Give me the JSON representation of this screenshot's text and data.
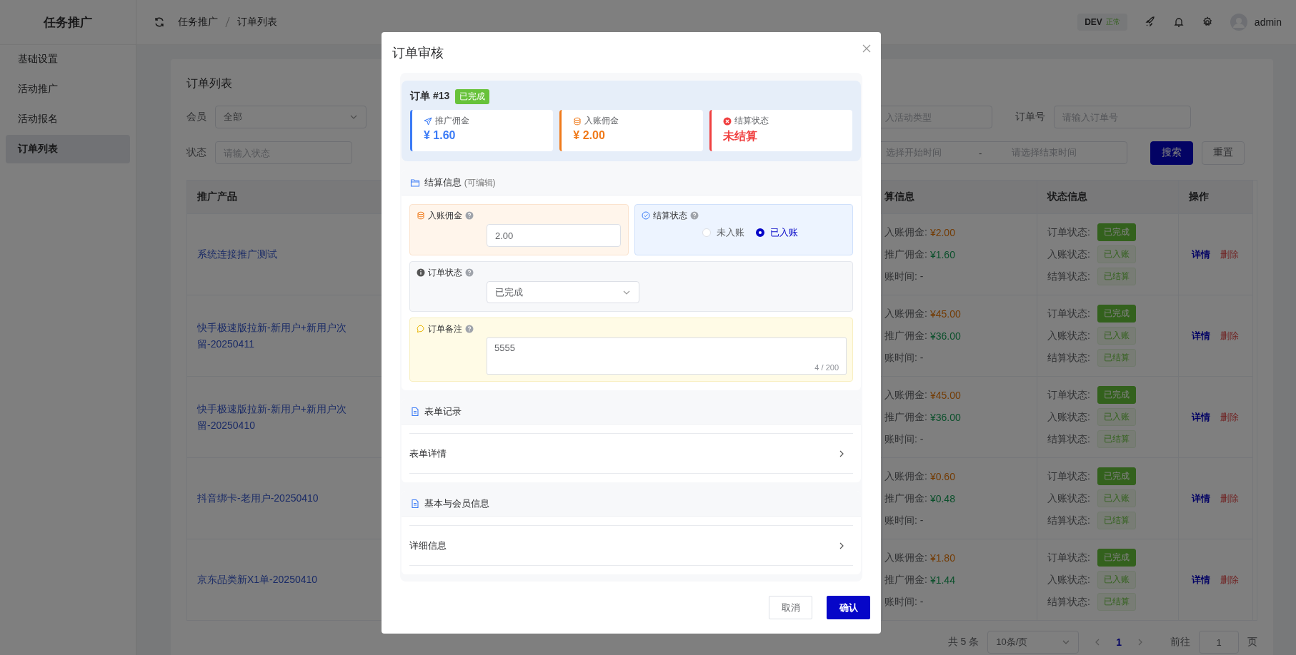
{
  "sidebar": {
    "brand": "任务推广",
    "items": [
      {
        "label": "基础设置",
        "selected": false
      },
      {
        "label": "活动推广",
        "selected": false
      },
      {
        "label": "活动报名",
        "selected": false
      },
      {
        "label": "订单列表",
        "selected": true
      }
    ]
  },
  "header": {
    "breadcrumb": [
      "任务推广",
      "订单列表"
    ],
    "env": {
      "name": "DEV",
      "status": "正常"
    },
    "user": "admin"
  },
  "page": {
    "title": "订单列表",
    "filters": {
      "member": {
        "label": "会员",
        "value": "全部"
      },
      "activity_type": {
        "placeholder": "入活动类型"
      },
      "order_no": {
        "label": "订单号",
        "placeholder": "请输入订单号"
      },
      "status": {
        "label": "状态",
        "placeholder": "请输入状态"
      },
      "date_range": {
        "start_placeholder": "选择开始时间",
        "separator": "-",
        "end_placeholder": "请选择结束时间"
      },
      "buttons": [
        "搜索",
        "重置"
      ]
    },
    "table": {
      "columns": [
        "推广产品",
        "算信息",
        "状态信息",
        "操作"
      ],
      "rows": [
        {
          "product": "系统连接推广测试",
          "settlement": [
            {
              "kind": "income",
              "label": "入账佣金:",
              "value": "¥2.00"
            },
            {
              "kind": "promo",
              "label": "推广佣金:",
              "value": "¥1.60"
            },
            {
              "kind": "time",
              "text": "账时间: -"
            }
          ],
          "statuses": [
            {
              "kind": "solid",
              "label": "订单状态:",
              "tag": "已完成"
            },
            {
              "kind": "light",
              "label": "入账状态:",
              "tag": "已入账"
            },
            {
              "kind": "light",
              "label": "结算状态:",
              "tag": "已结算"
            }
          ],
          "actions": [
            "详情",
            "删除"
          ]
        },
        {
          "product": "快手极速版拉新-新用户+新用户次留-20250411",
          "settlement": [
            {
              "kind": "income",
              "label": "入账佣金:",
              "value": "¥45.00"
            },
            {
              "kind": "promo",
              "label": "推广佣金:",
              "value": "¥36.00"
            },
            {
              "kind": "time",
              "text": "账时间: -"
            }
          ],
          "statuses": [
            {
              "kind": "solid",
              "label": "订单状态:",
              "tag": "已完成"
            },
            {
              "kind": "light",
              "label": "入账状态:",
              "tag": "已入账"
            },
            {
              "kind": "light",
              "label": "结算状态:",
              "tag": "已结算"
            }
          ],
          "actions": [
            "详情",
            "删除"
          ]
        },
        {
          "product": "快手极速版拉新-新用户+新用户次留-20250410",
          "settlement": [
            {
              "kind": "income",
              "label": "入账佣金:",
              "value": "¥45.00"
            },
            {
              "kind": "promo",
              "label": "推广佣金:",
              "value": "¥36.00"
            },
            {
              "kind": "time",
              "text": "账时间: -"
            }
          ],
          "statuses": [
            {
              "kind": "solid",
              "label": "订单状态:",
              "tag": "已完成"
            },
            {
              "kind": "light",
              "label": "入账状态:",
              "tag": "已入账"
            },
            {
              "kind": "light",
              "label": "结算状态:",
              "tag": "已结算"
            }
          ],
          "actions": [
            "详情",
            "删除"
          ]
        },
        {
          "product": "抖音绑卡-老用户-20250410",
          "settlement": [
            {
              "kind": "income",
              "label": "入账佣金:",
              "value": "¥0.60"
            },
            {
              "kind": "promo",
              "label": "推广佣金:",
              "value": "¥0.48"
            },
            {
              "kind": "time",
              "text": "账时间: -"
            }
          ],
          "statuses": [
            {
              "kind": "solid",
              "label": "订单状态:",
              "tag": "已完成"
            },
            {
              "kind": "light",
              "label": "入账状态:",
              "tag": "已入账"
            },
            {
              "kind": "light",
              "label": "结算状态:",
              "tag": "已结算"
            }
          ],
          "actions": [
            "详情",
            "删除"
          ]
        },
        {
          "product": "京东品类新X1单-20250410",
          "settlement": [
            {
              "kind": "income",
              "label": "入账佣金:",
              "value": "¥1.80"
            },
            {
              "kind": "promo",
              "label": "推广佣金:",
              "value": "¥1.44"
            },
            {
              "kind": "time",
              "text": "账时间: -"
            }
          ],
          "statuses": [
            {
              "kind": "solid",
              "label": "订单状态:",
              "tag": "已完成"
            },
            {
              "kind": "light",
              "label": "入账状态:",
              "tag": "已入账"
            },
            {
              "kind": "light",
              "label": "结算状态:",
              "tag": "已结算"
            }
          ],
          "actions": [
            "详情",
            "删除"
          ]
        }
      ]
    },
    "pagination": {
      "total": "共 5 条",
      "page_size": "10条/页",
      "pages": [
        {
          "label": "1",
          "selected": true
        }
      ],
      "goto_label": "前往",
      "goto_value": "1",
      "page_suffix": "页"
    }
  },
  "dialog": {
    "title": "订单审核",
    "order": {
      "title": "订单 #13",
      "status": "已完成"
    },
    "stats": [
      {
        "kind": "promo",
        "label": "推广佣金",
        "value": "¥ 1.60"
      },
      {
        "kind": "income",
        "label": "入账佣金",
        "value": "¥ 2.00"
      },
      {
        "kind": "settle",
        "label": "结算状态",
        "value": "未结算"
      }
    ],
    "settlement": {
      "title": "结算信息",
      "note": "(可编辑)",
      "income": {
        "label": "入账佣金",
        "value": "2.00"
      },
      "settle_status": {
        "label": "结算状态",
        "options": [
          {
            "label": "未入账",
            "selected": false
          },
          {
            "label": "已入账",
            "selected": true
          }
        ]
      },
      "order_status": {
        "label": "订单状态",
        "value": "已完成"
      },
      "remark": {
        "label": "订单备注",
        "value": "5555",
        "counter": "4 / 200"
      }
    },
    "sections": [
      {
        "title": "表单记录",
        "row": "表单详情"
      },
      {
        "title": "基本与会员信息",
        "row": "详细信息"
      }
    ],
    "buttons": [
      {
        "kind": "default",
        "label": "取消"
      },
      {
        "kind": "primary",
        "label": "确认"
      }
    ]
  }
}
